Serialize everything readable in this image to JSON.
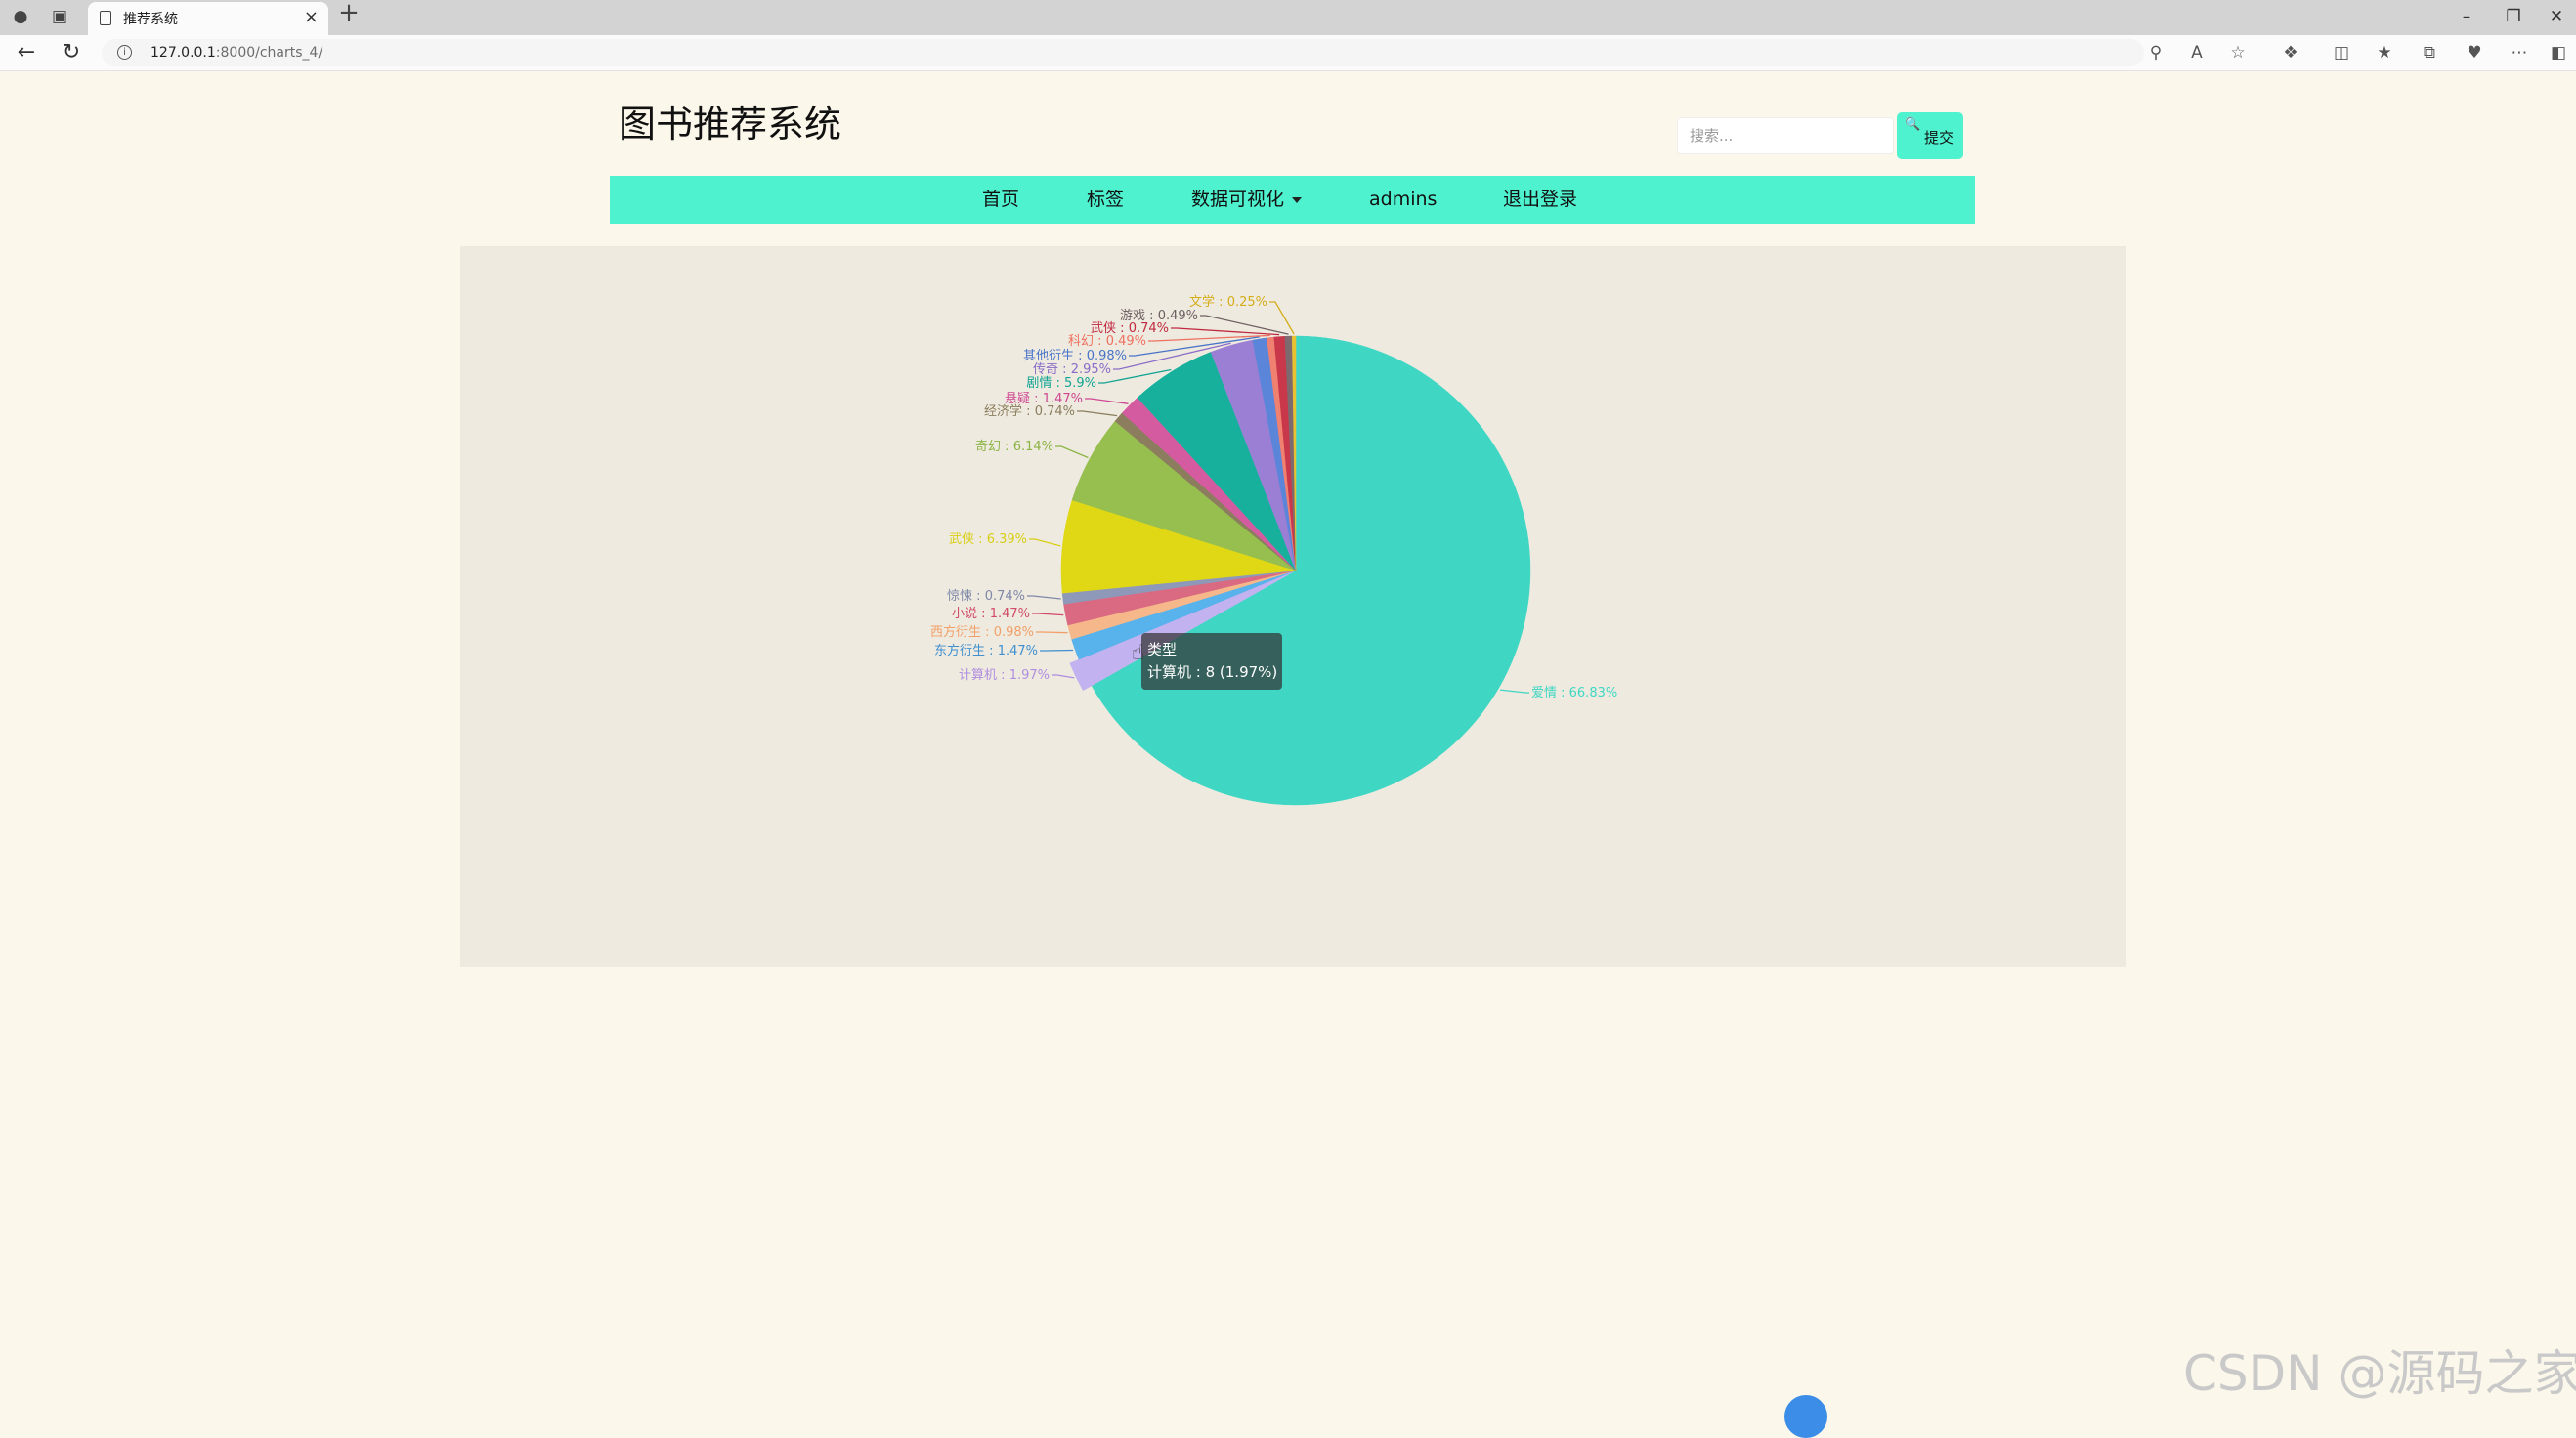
{
  "browser": {
    "tab_title": "推荐系统",
    "url_host": "127.0.0.1",
    "url_rest": ":8000/charts_4/"
  },
  "site": {
    "title": "图书推荐系统",
    "search_placeholder": "搜索...",
    "submit_label": "提交"
  },
  "nav": {
    "items": [
      "首页",
      "标签",
      "数据可视化",
      "admins",
      "退出登录"
    ]
  },
  "chart_data": {
    "type": "pie",
    "series_name": "类型",
    "slices": [
      {
        "name": "爱情",
        "percent": 66.83,
        "color": "#3fd7c4"
      },
      {
        "name": "计算机",
        "percent": 1.97,
        "color": "#c3b2f0"
      },
      {
        "name": "东方衍生",
        "percent": 1.47,
        "color": "#58b2ec"
      },
      {
        "name": "西方衍生",
        "percent": 0.98,
        "color": "#f6b88a"
      },
      {
        "name": "小说",
        "percent": 1.47,
        "color": "#da6a82"
      },
      {
        "name": "惊悚",
        "percent": 0.74,
        "color": "#8e98b9"
      },
      {
        "name": "武侠",
        "percent": 6.39,
        "color": "#e0d815"
      },
      {
        "name": "奇幻",
        "percent": 6.14,
        "color": "#97bf4f"
      },
      {
        "name": "经济学",
        "percent": 0.74,
        "color": "#8b7d5d"
      },
      {
        "name": "悬疑",
        "percent": 1.47,
        "color": "#d55ba0"
      },
      {
        "name": "剧情",
        "percent": 5.9,
        "color": "#17b09d"
      },
      {
        "name": "传奇",
        "percent": 2.95,
        "color": "#9b7fd4"
      },
      {
        "name": "其他衍生",
        "percent": 0.98,
        "color": "#5b85d9"
      },
      {
        "name": "科幻",
        "percent": 0.49,
        "color": "#f08070"
      },
      {
        "name": "武侠",
        "percent": 0.74,
        "color": "#c9374a"
      },
      {
        "name": "游戏",
        "percent": 0.49,
        "color": "#7d6a6e"
      },
      {
        "name": "文学",
        "percent": 0.25,
        "color": "#e9c232"
      }
    ],
    "labels": [
      {
        "text": "爱情 : 66.83%",
        "color": "#3fd7c4"
      },
      {
        "text": "计算机 : 1.97%",
        "color": "#b08ee0"
      },
      {
        "text": "东方衍生 : 1.47%",
        "color": "#3f8fd0"
      },
      {
        "text": "西方衍生 : 0.98%",
        "color": "#f2a06a"
      },
      {
        "text": "小说 : 1.47%",
        "color": "#d24a68"
      },
      {
        "text": "惊悚 : 0.74%",
        "color": "#7f88a8"
      },
      {
        "text": "武侠 : 6.39%",
        "color": "#d8cf13"
      },
      {
        "text": "奇幻 : 6.14%",
        "color": "#8bb445"
      },
      {
        "text": "经济学 : 0.74%",
        "color": "#8b7d5d"
      },
      {
        "text": "悬疑 : 1.47%",
        "color": "#cf4792"
      },
      {
        "text": "剧情 : 5.9%",
        "color": "#12a493"
      },
      {
        "text": "传奇 : 2.95%",
        "color": "#8a6cc8"
      },
      {
        "text": "其他衍生 : 0.98%",
        "color": "#4a74c8"
      },
      {
        "text": "科幻 : 0.49%",
        "color": "#ee7060"
      },
      {
        "text": "武侠 : 0.74%",
        "color": "#c02a40"
      },
      {
        "text": "游戏 : 0.49%",
        "color": "#6e5f62"
      },
      {
        "text": "文学 : 0.25%",
        "color": "#d4ad1a"
      }
    ],
    "tooltip": {
      "title": "类型",
      "text": "计算机 : 8 (1.97%)"
    }
  },
  "watermark": "CSDN @源码之家"
}
